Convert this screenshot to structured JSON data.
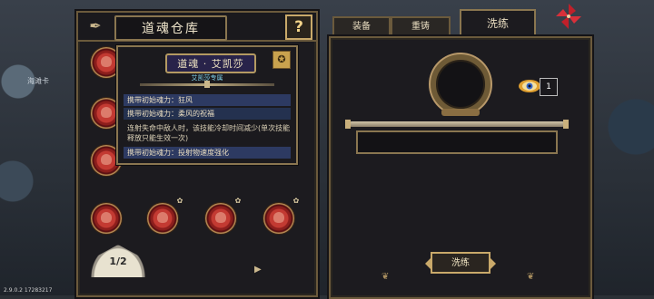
{
  "left_panel": {
    "title": "道魂仓库",
    "help_label": "?",
    "page_indicator": "1/2",
    "prev_arrow": "◀",
    "next_arrow": "▶"
  },
  "tooltip": {
    "name": "道魂 · 艾凯莎",
    "exclusive": "艾凯莎专属",
    "rows": [
      "携带初始魂力：狂风",
      "携带初始魂力：柔风的祝福",
      "连射失命中敌人时，该技能冷却时间减少(单次技能释放只能生效一次)",
      "携带初始魂力：投射物速度强化"
    ]
  },
  "tabs": {
    "equip": "装备",
    "recast": "重铸",
    "refine": "洗练"
  },
  "right_panel": {
    "material_count": "1",
    "refine_button": "洗练"
  },
  "background": {
    "partial_text": "海滩卡",
    "version": "2.9.0.2 17283217"
  },
  "icons": {
    "quill": "quill-pen-icon",
    "help": "question-mark-icon",
    "badge": "soul-badge-icon",
    "pinwheel": "pinwheel-icon",
    "material": "eye-material-icon"
  },
  "colors": {
    "accent_gold": "#c9a96a",
    "soul_red": "#c33a32",
    "tooltip_name_bg": "#28234a",
    "exclusive_text": "#7fd0e8"
  }
}
